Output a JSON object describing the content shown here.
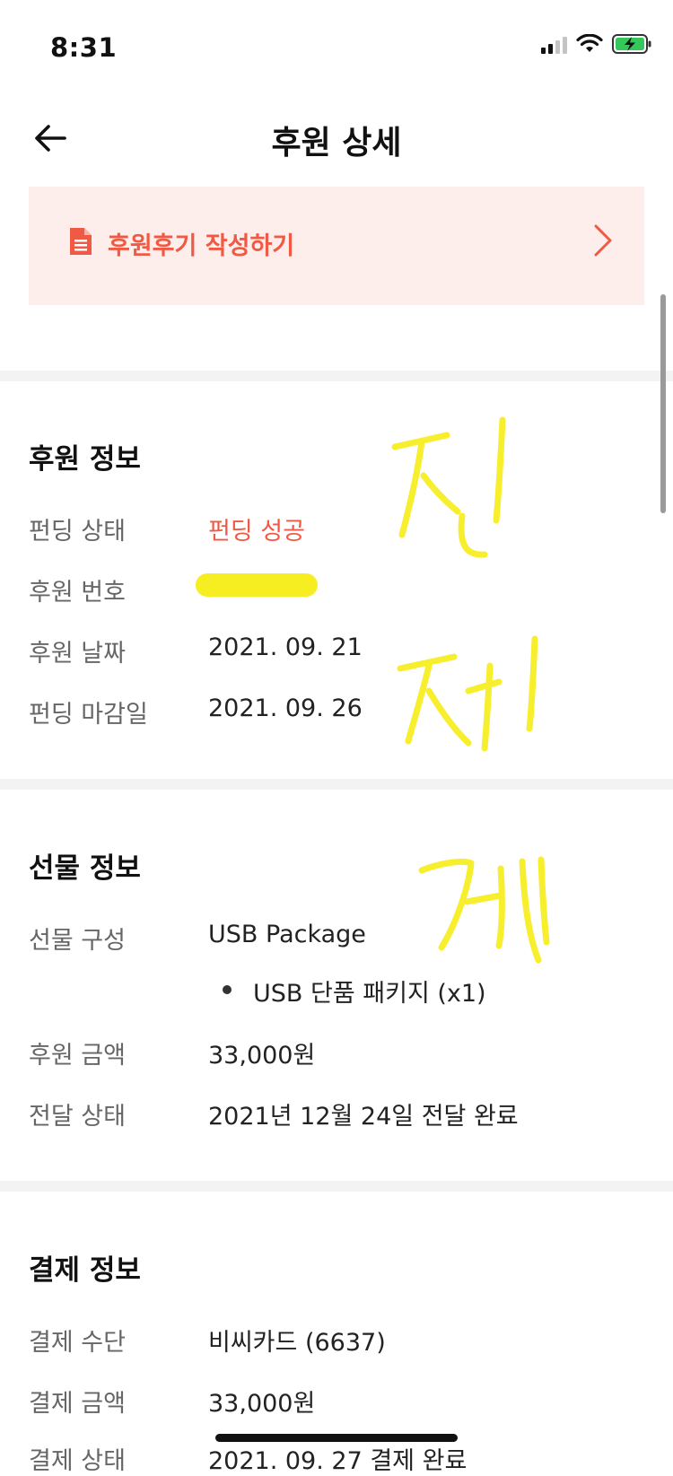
{
  "status_bar": {
    "time": "8:31"
  },
  "nav": {
    "title": "후원 상세"
  },
  "review_banner": {
    "label": "후원후기 작성하기"
  },
  "sponsor_info": {
    "title": "후원 정보",
    "rows": [
      {
        "label": "펀딩 상태",
        "value": "펀딩 성공"
      },
      {
        "label": "후원 번호",
        "value": ""
      },
      {
        "label": "후원 날짜",
        "value": "2021. 09. 21"
      },
      {
        "label": "펀딩 마감일",
        "value": "2021. 09. 26"
      }
    ]
  },
  "gift_info": {
    "title": "선물 정보",
    "rows": [
      {
        "label": "선물 구성",
        "value": "USB Package",
        "items": [
          "USB 단품 패키지 (x1)"
        ]
      },
      {
        "label": "후원 금액",
        "value": "33,000원"
      },
      {
        "label": "전달 상태",
        "value": "2021년 12월 24일 전달 완료"
      }
    ]
  },
  "payment_info": {
    "title": "결제 정보",
    "rows": [
      {
        "label": "결제 수단",
        "value": "비씨카드 (6637)"
      },
      {
        "label": "결제 금액",
        "value": "33,000원"
      },
      {
        "label": "결제 상태",
        "value": "2021. 09. 27 결제 완료"
      }
    ]
  },
  "colors": {
    "accent": "#f05a44",
    "banner_bg": "#fdeeeb",
    "divider": "#f3f3f3",
    "label": "#666666",
    "highlighter": "#f7ee22"
  }
}
